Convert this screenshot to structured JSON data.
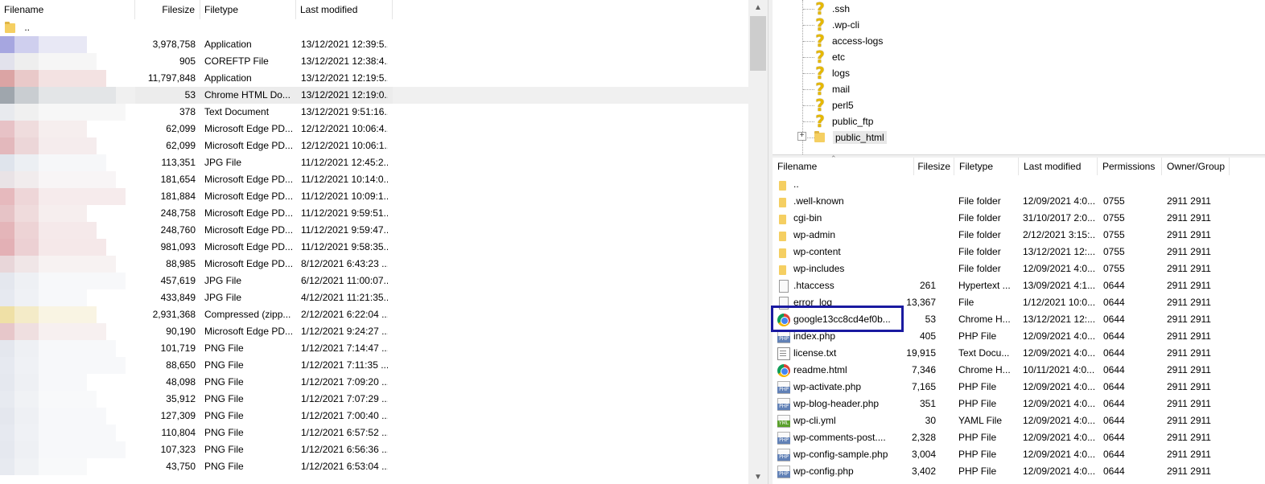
{
  "local": {
    "columns": {
      "filename": "Filename",
      "filesize": "Filesize",
      "filetype": "Filetype",
      "modified": "Last modified"
    },
    "parent": "..",
    "rows": [
      {
        "size": "3,978,758",
        "type": "Application",
        "modified": "13/12/2021 12:39:5...",
        "blur": [
          "#a6a6e0",
          "#cfcfee",
          "#e8e8f5"
        ]
      },
      {
        "size": "905",
        "type": "COREFTP File",
        "modified": "13/12/2021 12:38:4...",
        "blur": [
          "#e2e2ec",
          "#eeeeee",
          "#f6f6f6"
        ]
      },
      {
        "size": "11,797,848",
        "type": "Application",
        "modified": "13/12/2021 12:19:5...",
        "blur": [
          "#dba4a4",
          "#e9c9c9",
          "#f3e2e2"
        ]
      },
      {
        "size": "53",
        "type": "Chrome HTML Do...",
        "modified": "13/12/2021 12:19:0...",
        "blur": [
          "#9fa6ad",
          "#c9cdd1",
          "#e3e5e7"
        ],
        "selected": true
      },
      {
        "size": "378",
        "type": "Text Document",
        "modified": "13/12/2021 9:51:16...",
        "blur": [
          "#e8eaee",
          "#f0f0f0",
          "#f7f7f7"
        ]
      },
      {
        "size": "62,099",
        "type": "Microsoft Edge PD...",
        "modified": "12/12/2021 10:06:4...",
        "blur": [
          "#e7c2c6",
          "#efdcdd",
          "#f6eeee"
        ]
      },
      {
        "size": "62,099",
        "type": "Microsoft Edge PD...",
        "modified": "12/12/2021 10:06:1...",
        "blur": [
          "#e3b8bc",
          "#ecd6d8",
          "#f5eced"
        ]
      },
      {
        "size": "113,351",
        "type": "JPG File",
        "modified": "11/12/2021 12:45:2...",
        "blur": [
          "#dfe4ec",
          "#eceff3",
          "#f6f7f9"
        ]
      },
      {
        "size": "181,654",
        "type": "Microsoft Edge PD...",
        "modified": "11/12/2021 10:14:0...",
        "blur": [
          "#e9e3e6",
          "#f1eced",
          "#f8f5f6"
        ]
      },
      {
        "size": "181,884",
        "type": "Microsoft Edge PD...",
        "modified": "11/12/2021 10:09:1...",
        "blur": [
          "#e6b9bd",
          "#eed6d8",
          "#f6ebec"
        ]
      },
      {
        "size": "248,758",
        "type": "Microsoft Edge PD...",
        "modified": "11/12/2021 9:59:51...",
        "blur": [
          "#e6c3c6",
          "#efdbdc",
          "#f6eeee"
        ]
      },
      {
        "size": "248,760",
        "type": "Microsoft Edge PD...",
        "modified": "11/12/2021 9:59:47...",
        "blur": [
          "#e4b5b9",
          "#edd3d5",
          "#f5e9ea"
        ]
      },
      {
        "size": "981,093",
        "type": "Microsoft Edge PD...",
        "modified": "11/12/2021 9:58:35...",
        "blur": [
          "#e3b0b5",
          "#ecd0d3",
          "#f5e8e9"
        ]
      },
      {
        "size": "88,985",
        "type": "Microsoft Edge PD...",
        "modified": "8/12/2021 6:43:23 ...",
        "blur": [
          "#e8d6d9",
          "#f0e6e7",
          "#f7f2f2"
        ]
      },
      {
        "size": "457,619",
        "type": "JPG File",
        "modified": "6/12/2021 11:00:07...",
        "blur": [
          "#e4e7ee",
          "#eef0f4",
          "#f7f8fa"
        ]
      },
      {
        "size": "433,849",
        "type": "JPG File",
        "modified": "4/12/2021 11:21:35...",
        "blur": [
          "#e6e9f0",
          "#eff1f5",
          "#f7f8fa"
        ]
      },
      {
        "size": "2,931,368",
        "type": "Compressed (zipp...",
        "modified": "2/12/2021 6:22:04 ...",
        "blur": [
          "#efe0a6",
          "#f4ebc8",
          "#f9f4e3"
        ]
      },
      {
        "size": "90,190",
        "type": "Microsoft Edge PD...",
        "modified": "1/12/2021 9:24:27 ...",
        "blur": [
          "#e7c7ca",
          "#efdfe0",
          "#f7f0f0"
        ]
      },
      {
        "size": "101,719",
        "type": "PNG File",
        "modified": "1/12/2021 7:14:47 ...",
        "blur": [
          "#e4e7ee",
          "#eef0f4",
          "#f7f8fa"
        ]
      },
      {
        "size": "88,650",
        "type": "PNG File",
        "modified": "1/12/2021 7:11:35 ...",
        "blur": [
          "#e6e9f0",
          "#eff1f5",
          "#f7f8fa"
        ]
      },
      {
        "size": "48,098",
        "type": "PNG File",
        "modified": "1/12/2021 7:09:20 ...",
        "blur": [
          "#e5e8ef",
          "#eef0f4",
          "#f7f8fa"
        ]
      },
      {
        "size": "35,912",
        "type": "PNG File",
        "modified": "1/12/2021 7:07:29 ...",
        "blur": [
          "#e7eaf0",
          "#f0f2f5",
          "#f8f9fa"
        ]
      },
      {
        "size": "127,309",
        "type": "PNG File",
        "modified": "1/12/2021 7:00:40 ...",
        "blur": [
          "#e4e7ee",
          "#eef0f4",
          "#f7f8fa"
        ]
      },
      {
        "size": "110,804",
        "type": "PNG File",
        "modified": "1/12/2021 6:57:52 ...",
        "blur": [
          "#e6e9f0",
          "#eff1f5",
          "#f7f8fa"
        ]
      },
      {
        "size": "107,323",
        "type": "PNG File",
        "modified": "1/12/2021 6:56:36 ...",
        "blur": [
          "#e5e8ef",
          "#eef0f4",
          "#f7f8fa"
        ]
      },
      {
        "size": "43,750",
        "type": "PNG File",
        "modified": "1/12/2021 6:53:04 ...",
        "blur": [
          "#e7eaf0",
          "#f0f2f5",
          "#f8f9fa"
        ]
      }
    ]
  },
  "tree": {
    "items": [
      {
        "label": ".ssh",
        "icon": "unknown-folder-icon"
      },
      {
        "label": ".wp-cli",
        "icon": "unknown-folder-icon"
      },
      {
        "label": "access-logs",
        "icon": "unknown-folder-icon"
      },
      {
        "label": "etc",
        "icon": "unknown-folder-icon"
      },
      {
        "label": "logs",
        "icon": "unknown-folder-icon"
      },
      {
        "label": "mail",
        "icon": "unknown-folder-icon"
      },
      {
        "label": "perl5",
        "icon": "unknown-folder-icon"
      },
      {
        "label": "public_ftp",
        "icon": "unknown-folder-icon"
      },
      {
        "label": "public_html",
        "icon": "folder-icon",
        "selected": true
      }
    ]
  },
  "remote": {
    "columns": {
      "filename": "Filename",
      "filesize": "Filesize",
      "filetype": "Filetype",
      "modified": "Last modified",
      "permissions": "Permissions",
      "owner": "Owner/Group"
    },
    "rows": [
      {
        "name": "..",
        "size": "",
        "type": "",
        "modified": "",
        "perm": "",
        "owner": "",
        "icon": "folder"
      },
      {
        "name": ".well-known",
        "size": "",
        "type": "File folder",
        "modified": "12/09/2021 4:0...",
        "perm": "0755",
        "owner": "2911 2911",
        "icon": "folder"
      },
      {
        "name": "cgi-bin",
        "size": "",
        "type": "File folder",
        "modified": "31/10/2017 2:0...",
        "perm": "0755",
        "owner": "2911 2911",
        "icon": "folder"
      },
      {
        "name": "wp-admin",
        "size": "",
        "type": "File folder",
        "modified": "2/12/2021 3:15:...",
        "perm": "0755",
        "owner": "2911 2911",
        "icon": "folder"
      },
      {
        "name": "wp-content",
        "size": "",
        "type": "File folder",
        "modified": "13/12/2021 12:...",
        "perm": "0755",
        "owner": "2911 2911",
        "icon": "folder"
      },
      {
        "name": "wp-includes",
        "size": "",
        "type": "File folder",
        "modified": "12/09/2021 4:0...",
        "perm": "0755",
        "owner": "2911 2911",
        "icon": "folder"
      },
      {
        "name": ".htaccess",
        "size": "261",
        "type": "Hypertext ...",
        "modified": "13/09/2021 4:1...",
        "perm": "0644",
        "owner": "2911 2911",
        "icon": "file"
      },
      {
        "name": "error_log",
        "size": "13,367",
        "type": "File",
        "modified": "1/12/2021 10:0...",
        "perm": "0644",
        "owner": "2911 2911",
        "icon": "file"
      },
      {
        "name": "google13cc8cd4ef0b...",
        "size": "53",
        "type": "Chrome H...",
        "modified": "13/12/2021 12:...",
        "perm": "0644",
        "owner": "2911 2911",
        "icon": "chrome"
      },
      {
        "name": "index.php",
        "size": "405",
        "type": "PHP File",
        "modified": "12/09/2021 4:0...",
        "perm": "0644",
        "owner": "2911 2911",
        "icon": "php"
      },
      {
        "name": "license.txt",
        "size": "19,915",
        "type": "Text Docu...",
        "modified": "12/09/2021 4:0...",
        "perm": "0644",
        "owner": "2911 2911",
        "icon": "txt"
      },
      {
        "name": "readme.html",
        "size": "7,346",
        "type": "Chrome H...",
        "modified": "10/11/2021 4:0...",
        "perm": "0644",
        "owner": "2911 2911",
        "icon": "chrome"
      },
      {
        "name": "wp-activate.php",
        "size": "7,165",
        "type": "PHP File",
        "modified": "12/09/2021 4:0...",
        "perm": "0644",
        "owner": "2911 2911",
        "icon": "php"
      },
      {
        "name": "wp-blog-header.php",
        "size": "351",
        "type": "PHP File",
        "modified": "12/09/2021 4:0...",
        "perm": "0644",
        "owner": "2911 2911",
        "icon": "php"
      },
      {
        "name": "wp-cli.yml",
        "size": "30",
        "type": "YAML File",
        "modified": "12/09/2021 4:0...",
        "perm": "0644",
        "owner": "2911 2911",
        "icon": "yml"
      },
      {
        "name": "wp-comments-post....",
        "size": "2,328",
        "type": "PHP File",
        "modified": "12/09/2021 4:0...",
        "perm": "0644",
        "owner": "2911 2911",
        "icon": "php"
      },
      {
        "name": "wp-config-sample.php",
        "size": "3,004",
        "type": "PHP File",
        "modified": "12/09/2021 4:0...",
        "perm": "0644",
        "owner": "2911 2911",
        "icon": "php"
      },
      {
        "name": "wp-config.php",
        "size": "3,402",
        "type": "PHP File",
        "modified": "12/09/2021 4:0...",
        "perm": "0644",
        "owner": "2911 2911",
        "icon": "php"
      }
    ]
  },
  "scrollbar": {
    "up_icon": "chevron-up-icon",
    "down_icon": "chevron-down-icon"
  },
  "colors": {
    "highlight_box": "#1a1aa0",
    "selected_row": "#ececec",
    "folder": "#f5cf62"
  }
}
